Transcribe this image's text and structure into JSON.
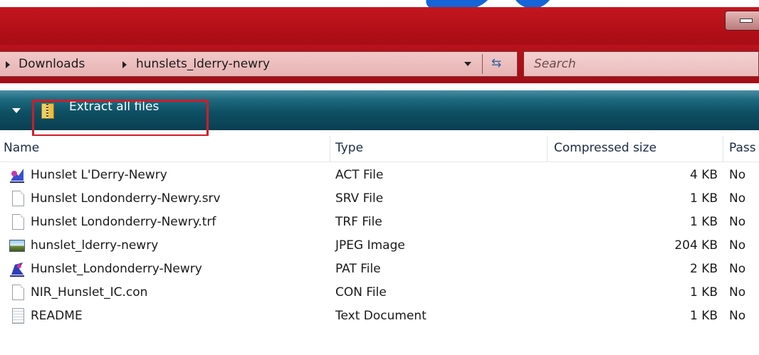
{
  "address": {
    "crumbs": [
      "Downloads",
      "hunslets_lderry-newry"
    ]
  },
  "search": {
    "placeholder": "Search"
  },
  "command_bar": {
    "extract_label": "Extract all files"
  },
  "columns": {
    "name": "Name",
    "type": "Type",
    "compressed_size": "Compressed size",
    "password": "Pass"
  },
  "files": [
    {
      "name": "Hunslet L'Derry-Newry",
      "type": "ACT File",
      "size": "4 KB",
      "password": "No",
      "icon": "act-file-icon"
    },
    {
      "name": "Hunslet Londonderry-Newry.srv",
      "type": "SRV File",
      "size": "1 KB",
      "password": "No",
      "icon": "document-icon"
    },
    {
      "name": "Hunslet Londonderry-Newry.trf",
      "type": "TRF File",
      "size": "1 KB",
      "password": "No",
      "icon": "document-icon"
    },
    {
      "name": "hunslet_lderry-newry",
      "type": "JPEG Image",
      "size": "204 KB",
      "password": "No",
      "icon": "image-icon"
    },
    {
      "name": "Hunslet_Londonderry-Newry",
      "type": "PAT File",
      "size": "2 KB",
      "password": "No",
      "icon": "pat-file-icon"
    },
    {
      "name": "NIR_Hunslet_IC.con",
      "type": "CON File",
      "size": "1 KB",
      "password": "No",
      "icon": "document-icon"
    },
    {
      "name": "README",
      "type": "Text Document",
      "size": "1 KB",
      "password": "No",
      "icon": "text-document-icon"
    }
  ],
  "colors": {
    "titlebar": "#b40f18",
    "command_bar": "#0e4f63",
    "highlight": "#d01c28"
  }
}
